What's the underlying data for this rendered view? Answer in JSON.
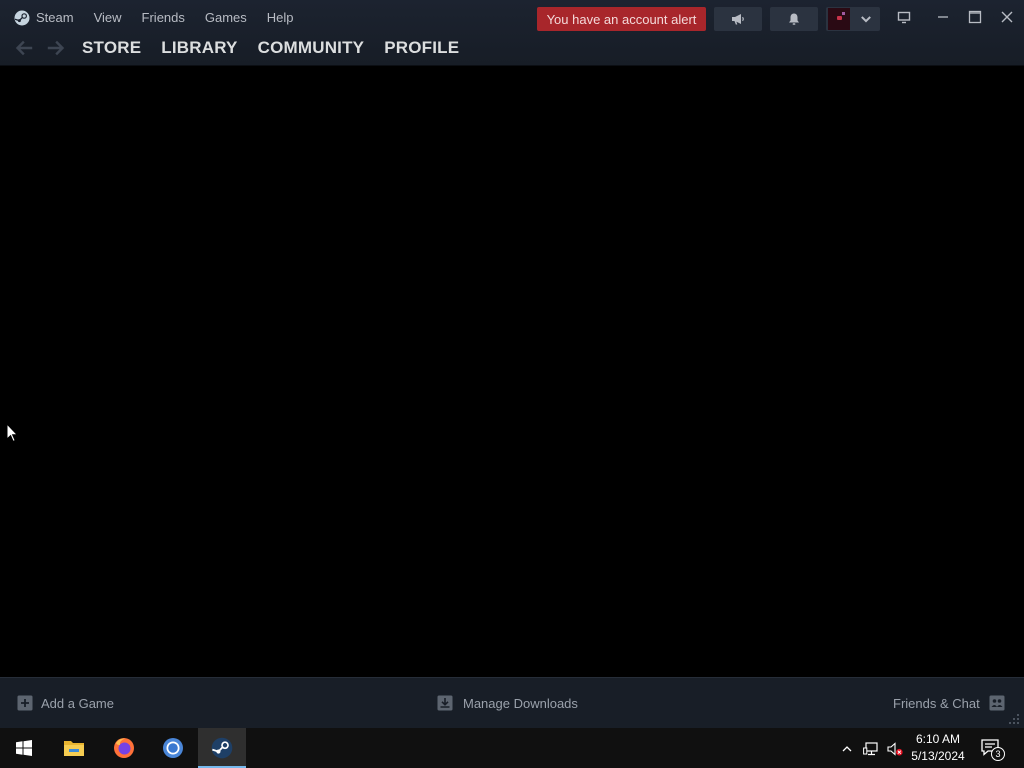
{
  "window": {
    "menu": {
      "steam": "Steam",
      "view": "View",
      "friends": "Friends",
      "games": "Games",
      "help": "Help"
    },
    "nav": {
      "store": "STORE",
      "library": "LIBRARY",
      "community": "COMMUNITY",
      "profile": "PROFILE"
    },
    "account_alert": "You have an account alert",
    "bottom_bar": {
      "add_game": "Add a Game",
      "manage_downloads": "Manage Downloads",
      "friends_chat": "Friends & Chat"
    }
  },
  "taskbar": {
    "apps": [
      "start-menu",
      "file-explorer",
      "firefox",
      "chrome",
      "steam"
    ],
    "active_app": "steam",
    "clock": {
      "time": "6:10 AM",
      "date": "5/13/2024"
    },
    "notification_count": "3"
  },
  "colors": {
    "titlebar": "#1c2330",
    "alert": "#a8262b",
    "bottombar": "#181e27",
    "taskbar": "#101010"
  }
}
